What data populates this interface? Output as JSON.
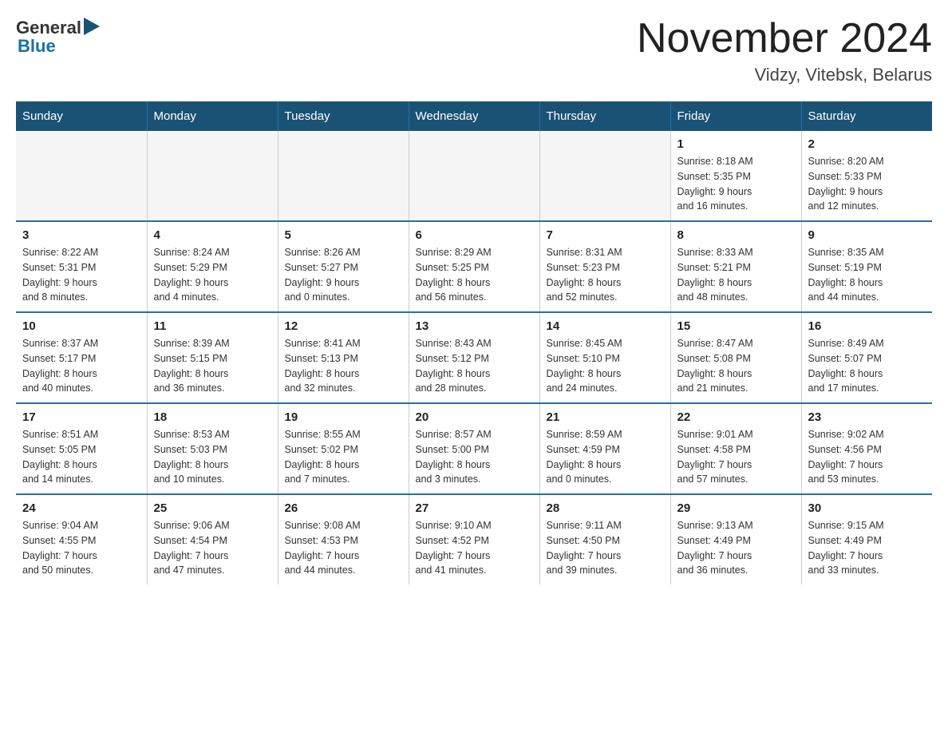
{
  "header": {
    "logo_general": "General",
    "logo_blue": "Blue",
    "month_title": "November 2024",
    "location": "Vidzy, Vitebsk, Belarus"
  },
  "weekdays": [
    "Sunday",
    "Monday",
    "Tuesday",
    "Wednesday",
    "Thursday",
    "Friday",
    "Saturday"
  ],
  "weeks": [
    [
      {
        "day": "",
        "info": ""
      },
      {
        "day": "",
        "info": ""
      },
      {
        "day": "",
        "info": ""
      },
      {
        "day": "",
        "info": ""
      },
      {
        "day": "",
        "info": ""
      },
      {
        "day": "1",
        "info": "Sunrise: 8:18 AM\nSunset: 5:35 PM\nDaylight: 9 hours\nand 16 minutes."
      },
      {
        "day": "2",
        "info": "Sunrise: 8:20 AM\nSunset: 5:33 PM\nDaylight: 9 hours\nand 12 minutes."
      }
    ],
    [
      {
        "day": "3",
        "info": "Sunrise: 8:22 AM\nSunset: 5:31 PM\nDaylight: 9 hours\nand 8 minutes."
      },
      {
        "day": "4",
        "info": "Sunrise: 8:24 AM\nSunset: 5:29 PM\nDaylight: 9 hours\nand 4 minutes."
      },
      {
        "day": "5",
        "info": "Sunrise: 8:26 AM\nSunset: 5:27 PM\nDaylight: 9 hours\nand 0 minutes."
      },
      {
        "day": "6",
        "info": "Sunrise: 8:29 AM\nSunset: 5:25 PM\nDaylight: 8 hours\nand 56 minutes."
      },
      {
        "day": "7",
        "info": "Sunrise: 8:31 AM\nSunset: 5:23 PM\nDaylight: 8 hours\nand 52 minutes."
      },
      {
        "day": "8",
        "info": "Sunrise: 8:33 AM\nSunset: 5:21 PM\nDaylight: 8 hours\nand 48 minutes."
      },
      {
        "day": "9",
        "info": "Sunrise: 8:35 AM\nSunset: 5:19 PM\nDaylight: 8 hours\nand 44 minutes."
      }
    ],
    [
      {
        "day": "10",
        "info": "Sunrise: 8:37 AM\nSunset: 5:17 PM\nDaylight: 8 hours\nand 40 minutes."
      },
      {
        "day": "11",
        "info": "Sunrise: 8:39 AM\nSunset: 5:15 PM\nDaylight: 8 hours\nand 36 minutes."
      },
      {
        "day": "12",
        "info": "Sunrise: 8:41 AM\nSunset: 5:13 PM\nDaylight: 8 hours\nand 32 minutes."
      },
      {
        "day": "13",
        "info": "Sunrise: 8:43 AM\nSunset: 5:12 PM\nDaylight: 8 hours\nand 28 minutes."
      },
      {
        "day": "14",
        "info": "Sunrise: 8:45 AM\nSunset: 5:10 PM\nDaylight: 8 hours\nand 24 minutes."
      },
      {
        "day": "15",
        "info": "Sunrise: 8:47 AM\nSunset: 5:08 PM\nDaylight: 8 hours\nand 21 minutes."
      },
      {
        "day": "16",
        "info": "Sunrise: 8:49 AM\nSunset: 5:07 PM\nDaylight: 8 hours\nand 17 minutes."
      }
    ],
    [
      {
        "day": "17",
        "info": "Sunrise: 8:51 AM\nSunset: 5:05 PM\nDaylight: 8 hours\nand 14 minutes."
      },
      {
        "day": "18",
        "info": "Sunrise: 8:53 AM\nSunset: 5:03 PM\nDaylight: 8 hours\nand 10 minutes."
      },
      {
        "day": "19",
        "info": "Sunrise: 8:55 AM\nSunset: 5:02 PM\nDaylight: 8 hours\nand 7 minutes."
      },
      {
        "day": "20",
        "info": "Sunrise: 8:57 AM\nSunset: 5:00 PM\nDaylight: 8 hours\nand 3 minutes."
      },
      {
        "day": "21",
        "info": "Sunrise: 8:59 AM\nSunset: 4:59 PM\nDaylight: 8 hours\nand 0 minutes."
      },
      {
        "day": "22",
        "info": "Sunrise: 9:01 AM\nSunset: 4:58 PM\nDaylight: 7 hours\nand 57 minutes."
      },
      {
        "day": "23",
        "info": "Sunrise: 9:02 AM\nSunset: 4:56 PM\nDaylight: 7 hours\nand 53 minutes."
      }
    ],
    [
      {
        "day": "24",
        "info": "Sunrise: 9:04 AM\nSunset: 4:55 PM\nDaylight: 7 hours\nand 50 minutes."
      },
      {
        "day": "25",
        "info": "Sunrise: 9:06 AM\nSunset: 4:54 PM\nDaylight: 7 hours\nand 47 minutes."
      },
      {
        "day": "26",
        "info": "Sunrise: 9:08 AM\nSunset: 4:53 PM\nDaylight: 7 hours\nand 44 minutes."
      },
      {
        "day": "27",
        "info": "Sunrise: 9:10 AM\nSunset: 4:52 PM\nDaylight: 7 hours\nand 41 minutes."
      },
      {
        "day": "28",
        "info": "Sunrise: 9:11 AM\nSunset: 4:50 PM\nDaylight: 7 hours\nand 39 minutes."
      },
      {
        "day": "29",
        "info": "Sunrise: 9:13 AM\nSunset: 4:49 PM\nDaylight: 7 hours\nand 36 minutes."
      },
      {
        "day": "30",
        "info": "Sunrise: 9:15 AM\nSunset: 4:49 PM\nDaylight: 7 hours\nand 33 minutes."
      }
    ]
  ]
}
